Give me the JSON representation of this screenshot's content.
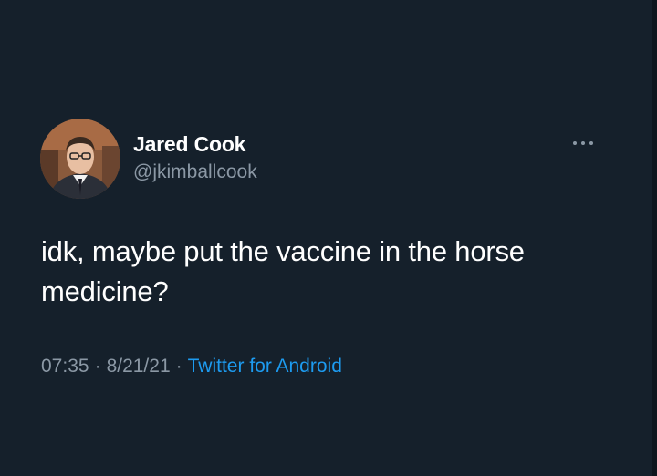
{
  "tweet": {
    "author": {
      "name": "Jared Cook",
      "handle": "@jkimballcook"
    },
    "text": "idk, maybe put the vaccine in the horse medicine?",
    "time": "07:35",
    "date": "8/21/21",
    "source": "Twitter for Android",
    "separator": "·"
  },
  "colors": {
    "background": "#15202b",
    "text": "#ffffff",
    "muted": "#8b98a5",
    "link": "#1d9bf0"
  },
  "icons": {
    "avatar": "profile-photo",
    "more": "more-icon"
  }
}
